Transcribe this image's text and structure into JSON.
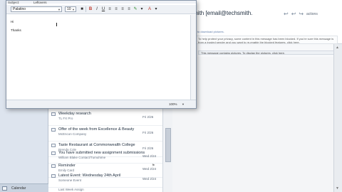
{
  "compose": {
    "subject_label": "Subject:",
    "subject_value": "Leftovers",
    "font_name": "Palatino",
    "font_size": "10",
    "greeting": "Hi",
    "signoff": "Thanks",
    "zoom": "100%"
  },
  "reading": {
    "from": "techsmith [email@techsmith.",
    "action": "actions",
    "link_line": "Click here to download pictures.",
    "info": "To help protect your privacy, some content in this message has been blocked. If you're sure this message is from a trusted sender and you want to re-enable the blocked features, click here.",
    "infobar": "This message contains pictures. To display the pictures, click here.",
    "sub": "Sent"
  },
  "list": {
    "rows": [
      {
        "subject": "Weekday research",
        "sender": "TL FX Pro",
        "date": "Fri 2/26"
      },
      {
        "subject": "Offer of the week from Excellence & Beauty",
        "sender": "McEncon Company",
        "date": "Fri 2/26"
      },
      {
        "subject": "Taste Restaurant at Commonwealth College",
        "sender": "Brenda Cole",
        "date": "Fri 2/26"
      },
      {
        "subject": "You have submitted new assignment submissions",
        "sender": "William Blake Contact/Tumuhime",
        "date": "Wed 2/24"
      },
      {
        "subject": "Reminder",
        "sender": "Emily Card",
        "date": "Wed 2/24"
      },
      {
        "subject": "Latest Event: Wednesday 24th April",
        "sender": "Someone Event",
        "date": "Wed 2/24"
      }
    ],
    "footer": "Last Week Assign",
    "nav_label": "Calendar"
  },
  "colors": {
    "accent": "#3d6aa8",
    "bold": "#c0392b"
  }
}
